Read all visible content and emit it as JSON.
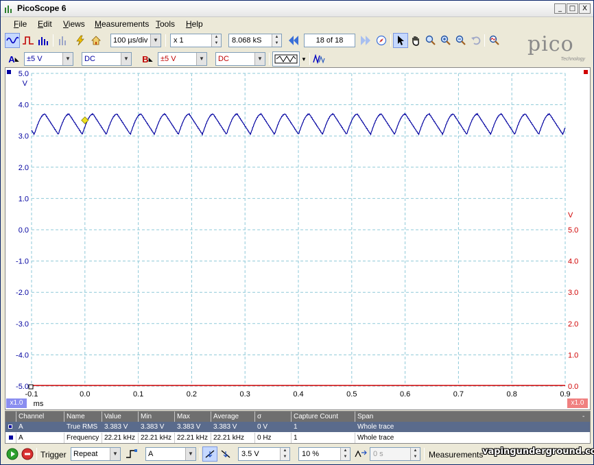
{
  "window": {
    "title": "PicoScope 6",
    "btn_min": "_",
    "btn_max": "□",
    "btn_close": "X"
  },
  "menu": [
    {
      "key": "F",
      "rest": "ile"
    },
    {
      "key": "E",
      "rest": "dit"
    },
    {
      "key": "V",
      "rest": "iews"
    },
    {
      "key": "M",
      "rest": "easurements"
    },
    {
      "key": "T",
      "rest": "ools"
    },
    {
      "key": "H",
      "rest": "elp"
    }
  ],
  "toolbar": {
    "timebase": "100 µs/div",
    "zoom": "x 1",
    "samples": "8.068 kS",
    "buffer": "18 of 18"
  },
  "channels": {
    "a_label": "A",
    "a_range": "±5 V",
    "a_coupling": "DC",
    "b_label": "B",
    "b_range": "±5 V",
    "b_coupling": "DC"
  },
  "logo": {
    "word": "pico",
    "sub": "Technology"
  },
  "colors": {
    "channel_a": "#0000a0",
    "channel_b": "#d00000",
    "grid": "#8ec9d8"
  },
  "chart_data": {
    "type": "line",
    "xlabel": "ms",
    "x_ticks": [
      "-0.1",
      "0.0",
      "0.1",
      "0.2",
      "0.3",
      "0.4",
      "0.5",
      "0.6",
      "0.7",
      "0.8",
      "0.9"
    ],
    "xlim": [
      -0.1,
      0.9
    ],
    "y_left_unit": "V",
    "y_left_ticks": [
      "5.0",
      "4.0",
      "3.0",
      "2.0",
      "1.0",
      "0.0",
      "-1.0",
      "-2.0",
      "-3.0",
      "-4.0",
      "-5.0"
    ],
    "ylim": [
      -5,
      5
    ],
    "y_right_unit": "V",
    "y_right_ticks": [
      "5.0",
      "4.0",
      "3.0",
      "2.0",
      "1.0",
      "0.0"
    ],
    "grid": true,
    "series": [
      {
        "channel": "A",
        "frequency_khz": 22.21,
        "min": 3.05,
        "max": 3.7,
        "offset_ms": -0.095
      },
      {
        "channel": "B",
        "value": -5.0
      }
    ],
    "trigger_marker": {
      "x": 0.0,
      "y": 3.5
    },
    "x_zoom_left": "x1.0",
    "x_zoom_right": "x1.0"
  },
  "measurements": {
    "headers": [
      "Channel",
      "Name",
      "Value",
      "Min",
      "Max",
      "Average",
      "σ",
      "Capture Count",
      "Span"
    ],
    "rows": [
      [
        "A",
        "True RMS",
        "3.383 V",
        "3.383 V",
        "3.383 V",
        "3.383 V",
        "0 V",
        "1",
        "Whole trace"
      ],
      [
        "A",
        "Frequency",
        "22.21 kHz",
        "22.21 kHz",
        "22.21 kHz",
        "22.21 kHz",
        "0 Hz",
        "1",
        "Whole trace"
      ]
    ],
    "collapse": "-"
  },
  "status": {
    "trigger_label": "Trigger",
    "trigger_mode": "Repeat",
    "trigger_channel": "A",
    "threshold": "3.5 V",
    "pretrigger": "10 %",
    "delay": "0 s",
    "measurements_label": "Measurements",
    "watermark": "vapingunderground.com"
  }
}
